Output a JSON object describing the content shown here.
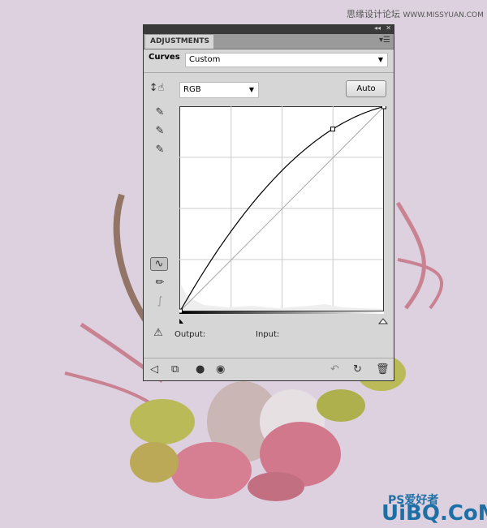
{
  "watermark_top": {
    "chinese": "思缘设计论坛",
    "url": "WWW.MISSYUAN.COM"
  },
  "watermark_bottom": {
    "logo": "PS爱好者",
    "url": "UiBQ.CoM"
  },
  "panel": {
    "tab": "ADJUSTMENTS",
    "preset_label": "Curves",
    "preset_value": "Custom",
    "channel_value": "RGB",
    "auto_label": "Auto",
    "output_label": "Output:",
    "input_label": "Input:",
    "icons": [
      "collapse-icon",
      "close-icon",
      "panel-menu-icon",
      "target-adjust-icon",
      "black-eyedropper-icon",
      "gray-eyedropper-icon",
      "white-eyedropper-icon",
      "curve-points-icon",
      "pencil-icon",
      "smooth-icon",
      "clipping-warning-icon",
      "back-icon",
      "clip-to-layer-icon",
      "visibility-mask-icon",
      "eye-icon",
      "view-previous-icon",
      "reset-icon",
      "trash-icon"
    ]
  },
  "chart_data": {
    "type": "line",
    "xlim": [
      0,
      255
    ],
    "ylim": [
      0,
      255
    ],
    "grid": true,
    "series": [
      {
        "points": [
          [
            0,
            0
          ],
          [
            191,
            227
          ],
          [
            255,
            255
          ]
        ]
      }
    ],
    "baseline": [
      [
        0,
        0
      ],
      [
        255,
        255
      ]
    ]
  },
  "colors": {
    "background": "#ddd1df",
    "panel": "#d6d6d6",
    "titlebar": "#3a3a3a"
  }
}
